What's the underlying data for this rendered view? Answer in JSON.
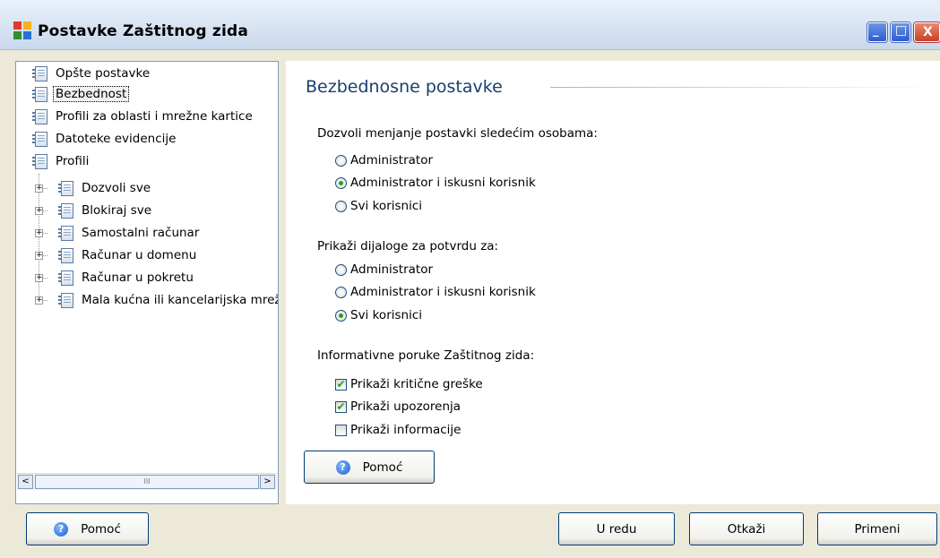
{
  "window": {
    "title": "Postavke Zaštitnog zida",
    "min_glyph": "_",
    "max_glyph": "□",
    "close_glyph": "X"
  },
  "tree": {
    "items": [
      {
        "label": "Opšte postavke",
        "level": 0,
        "expandable": false,
        "selected": false
      },
      {
        "label": "Bezbednost",
        "level": 0,
        "expandable": false,
        "selected": true
      },
      {
        "label": "Profili za oblasti i mrežne kartice",
        "level": 0,
        "expandable": false,
        "selected": false
      },
      {
        "label": "Datoteke evidencije",
        "level": 0,
        "expandable": false,
        "selected": false
      },
      {
        "label": "Profili",
        "level": 0,
        "expandable": false,
        "selected": false
      },
      {
        "label": "Dozvoli sve",
        "level": 1,
        "expandable": true,
        "selected": false
      },
      {
        "label": "Blokiraj sve",
        "level": 1,
        "expandable": true,
        "selected": false
      },
      {
        "label": "Samostalni računar",
        "level": 1,
        "expandable": true,
        "selected": false
      },
      {
        "label": "Računar u domenu",
        "level": 1,
        "expandable": true,
        "selected": false
      },
      {
        "label": "Računar u pokretu",
        "level": 1,
        "expandable": true,
        "selected": false
      },
      {
        "label": "Mala kućna ili kancelarijska mreža",
        "level": 1,
        "expandable": true,
        "selected": false
      }
    ],
    "scroll_left": "<",
    "scroll_right": ">",
    "scroll_grip": "III"
  },
  "content": {
    "title": "Bezbednosne postavke",
    "group1": {
      "label": "Dozvoli menjanje postavki sledećim osobama:",
      "options": [
        "Administrator",
        "Administrator i iskusni korisnik",
        "Svi korisnici"
      ],
      "selected_index": 1
    },
    "group2": {
      "label": "Prikaži dijaloge za potvrdu za:",
      "options": [
        "Administrator",
        "Administrator i iskusni korisnik",
        "Svi korisnici"
      ],
      "selected_index": 2
    },
    "group3": {
      "label": "Informativne poruke Zaštitnog zida:",
      "checks": [
        {
          "label": "Prikaži kritične greške",
          "checked": true
        },
        {
          "label": "Prikaži upozorenja",
          "checked": true
        },
        {
          "label": "Prikaži informacije",
          "checked": false
        }
      ]
    },
    "help_button": "Pomoć"
  },
  "footer": {
    "help": "Pomoć",
    "ok": "U redu",
    "cancel": "Otkaži",
    "apply": "Primeni"
  },
  "icons": {
    "help": "?",
    "check": "✔"
  }
}
